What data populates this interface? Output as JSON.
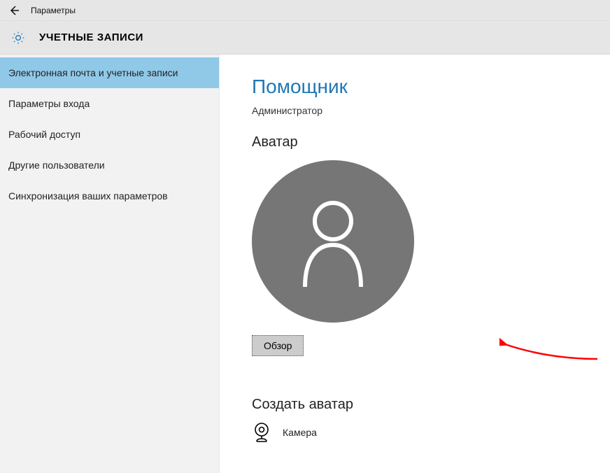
{
  "titlebar": {
    "window_title": "Параметры"
  },
  "header": {
    "title": "УЧЕТНЫЕ ЗАПИСИ"
  },
  "sidebar": {
    "items": [
      {
        "label": "Электронная почта и учетные записи",
        "selected": true
      },
      {
        "label": "Параметры входа",
        "selected": false
      },
      {
        "label": "Рабочий доступ",
        "selected": false
      },
      {
        "label": "Другие пользователи",
        "selected": false
      },
      {
        "label": "Синхронизация ваших параметров",
        "selected": false
      }
    ]
  },
  "content": {
    "user_name": "Помощник",
    "user_role": "Администратор",
    "avatar_heading": "Аватар",
    "browse_label": "Обзор",
    "create_avatar_heading": "Создать аватар",
    "camera_label": "Камера"
  },
  "colors": {
    "accent": "#1f77b6",
    "sidebar_selected": "#90c8e8",
    "sidebar_bg": "#f2f2f2",
    "avatar_bg": "#767676",
    "annotation_arrow": "#ff0000"
  }
}
